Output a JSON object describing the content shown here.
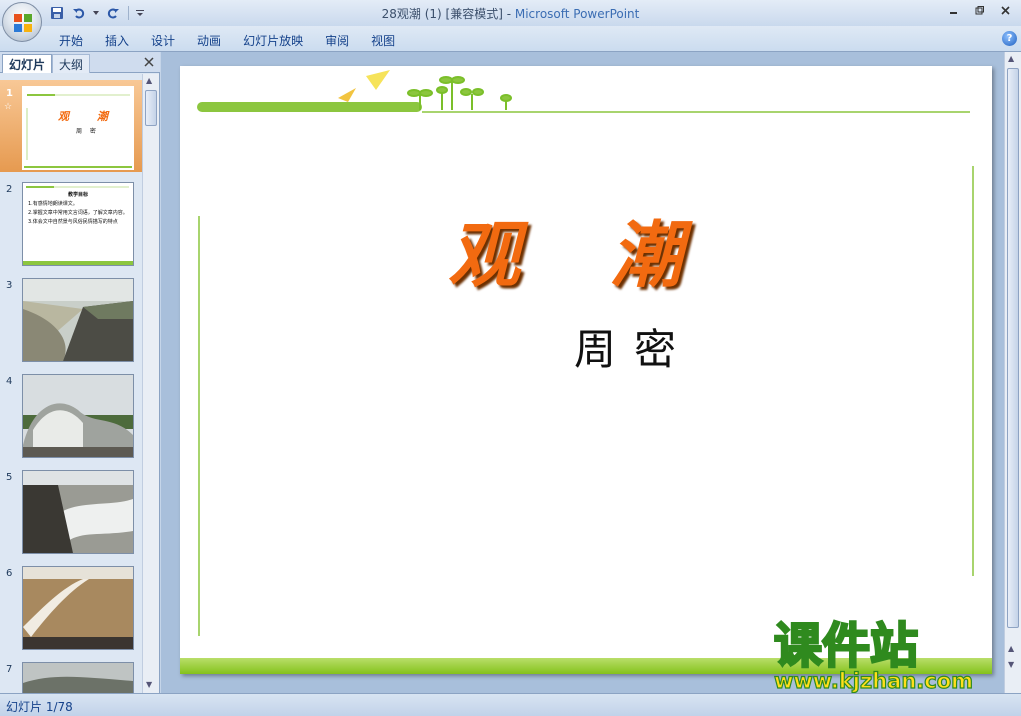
{
  "window": {
    "title_doc": "28观潮 (1) [兼容模式] - ",
    "title_app": "Microsoft PowerPoint"
  },
  "ribbon": {
    "tabs": [
      "开始",
      "插入",
      "设计",
      "动画",
      "幻灯片放映",
      "审阅",
      "视图"
    ]
  },
  "left_pane": {
    "tab_slides": "幻灯片",
    "tab_outline": "大纲",
    "thumbnails": [
      {
        "num": "1",
        "selected": true,
        "title": "观  潮",
        "subtitle": "周 密"
      },
      {
        "num": "2",
        "heading": "教学目标",
        "lines": [
          "1.有感情地朗读课文。",
          "2.掌握文章中常用文言词语，了解文章内容。",
          "3.体会文中自然景与风俗民情描写的特点"
        ]
      },
      {
        "num": "3"
      },
      {
        "num": "4"
      },
      {
        "num": "5"
      },
      {
        "num": "6"
      },
      {
        "num": "7"
      }
    ]
  },
  "slide": {
    "title": "观潮",
    "author": "周密"
  },
  "watermark": {
    "line1": "课件站",
    "line2": "www.kjzhan.com"
  },
  "status": {
    "slide_counter": "幻灯片 1/78"
  }
}
